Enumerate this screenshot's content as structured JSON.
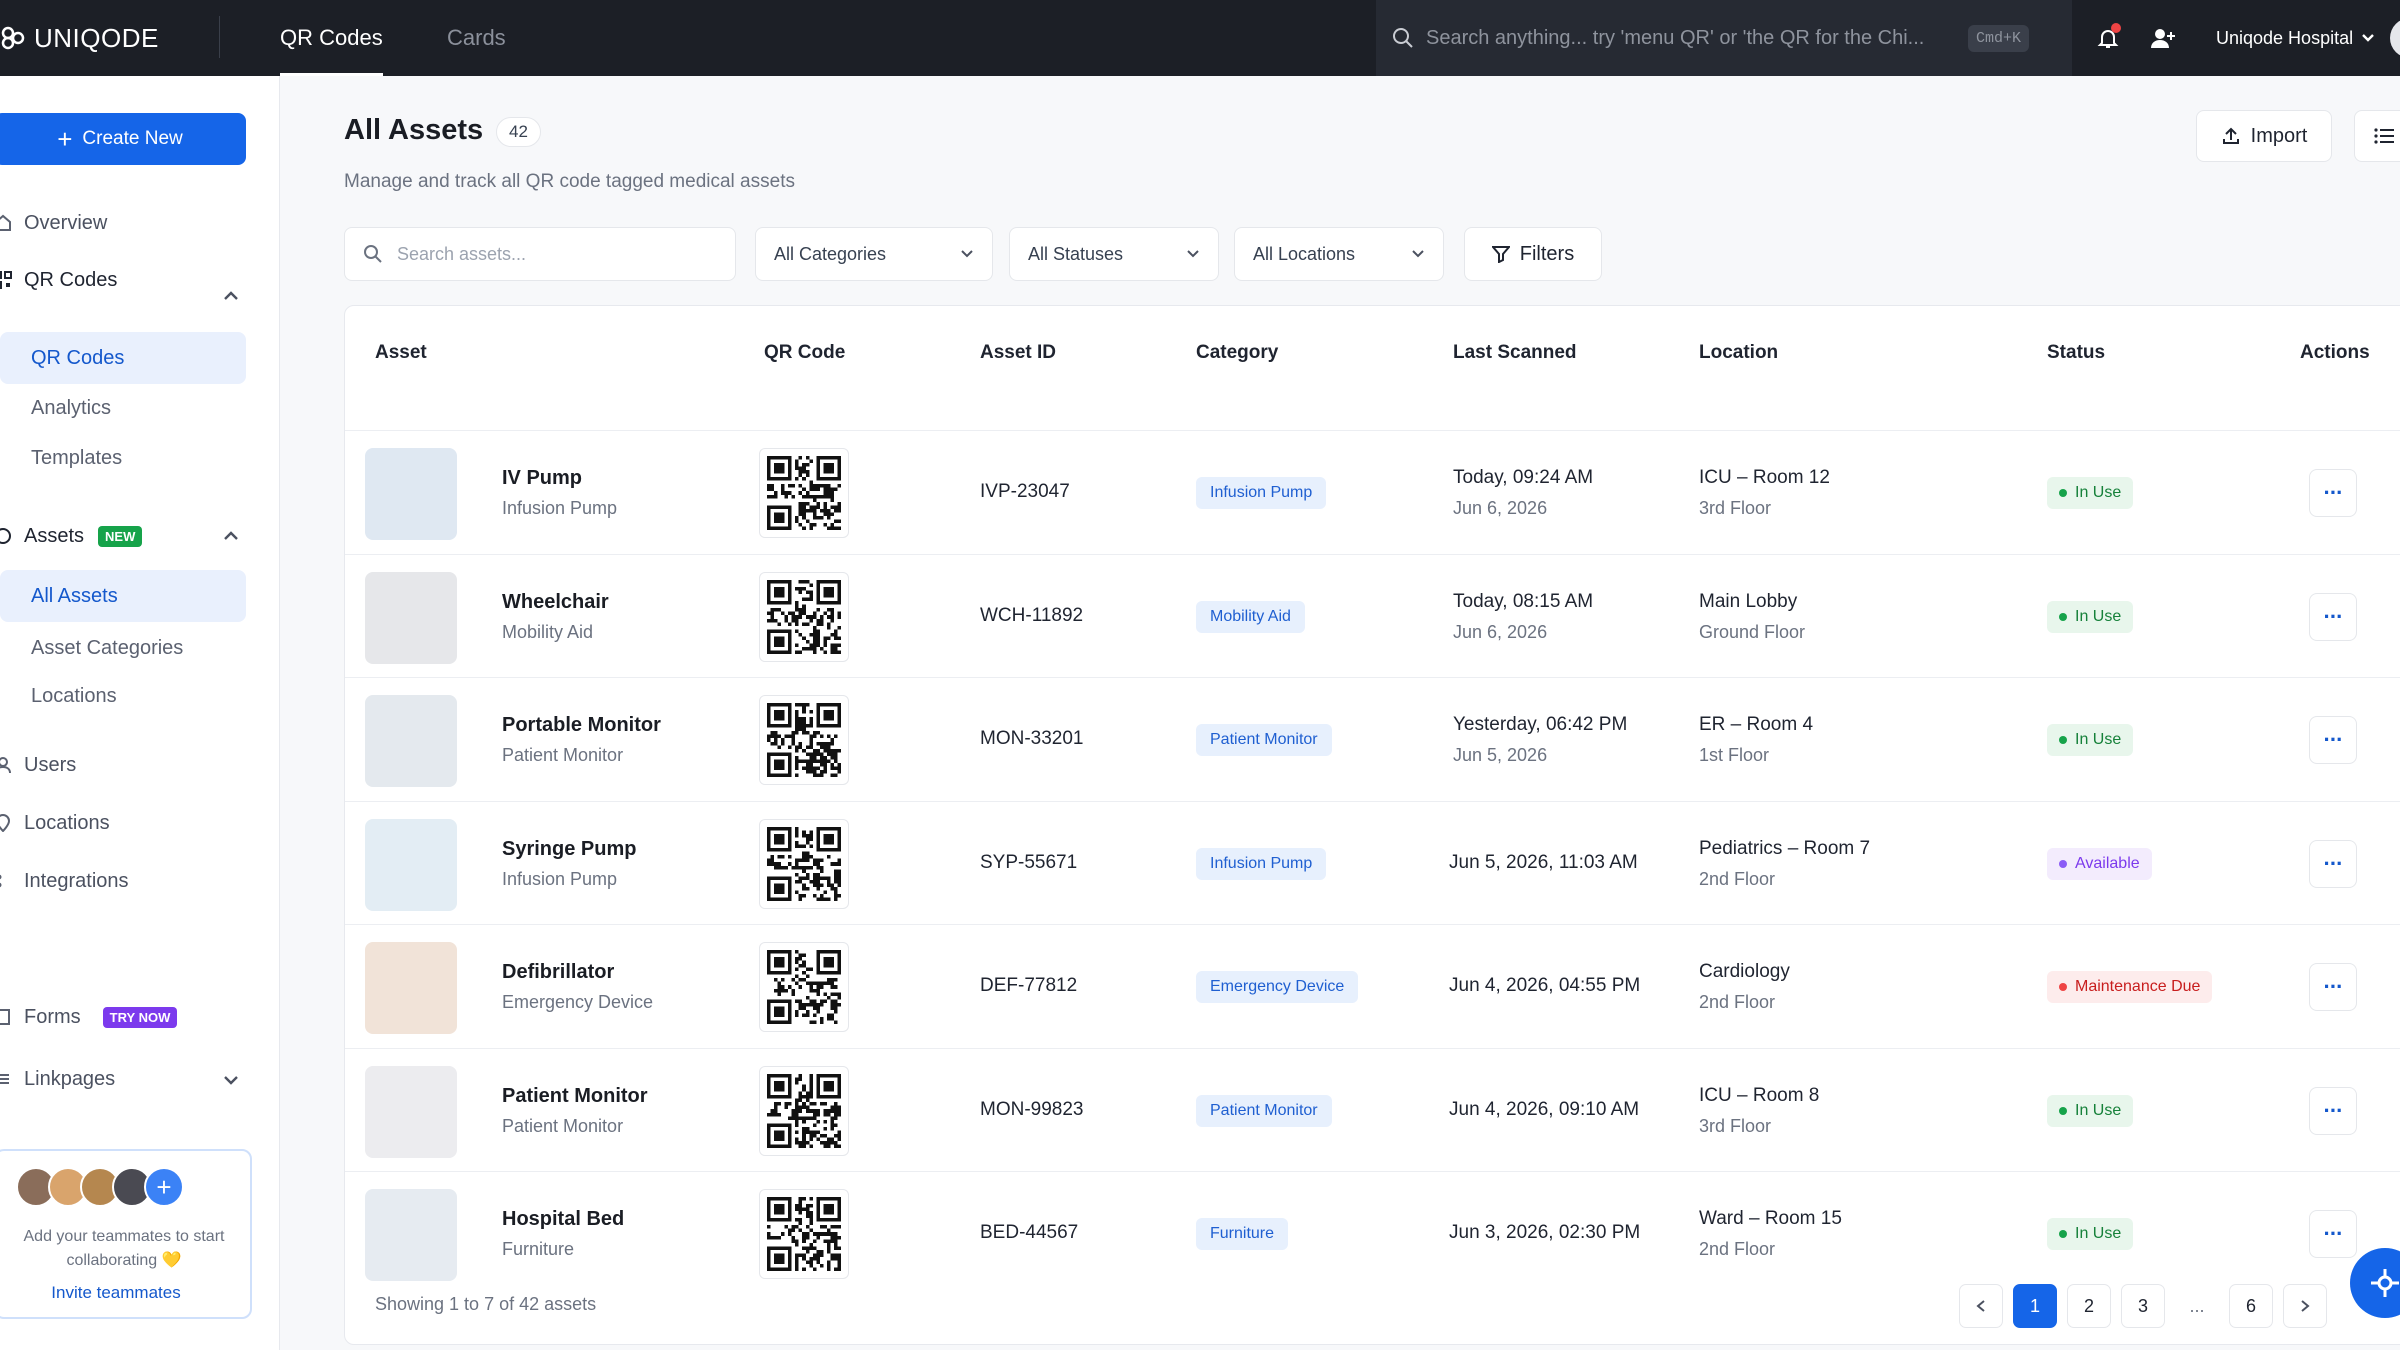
{
  "app": {
    "name": "UNIQODE",
    "org": "Uniqode Hospital",
    "accent": "#1565e8"
  },
  "top_tabs": [
    {
      "label": "QR Codes",
      "active": true
    },
    {
      "label": "Cards",
      "active": false
    }
  ],
  "global_search": {
    "placeholder": "Search anything... try 'menu QR' or 'the QR for the Chi...",
    "shortcut": "Cmd+K"
  },
  "sidebar": {
    "create_label": "Create New",
    "overview": "Overview",
    "qr_section": "QR Codes",
    "qr_items": [
      "QR Codes",
      "Analytics",
      "Templates"
    ],
    "assets_section": "Assets",
    "assets_badge": "NEW",
    "asset_items": [
      "All Assets",
      "Asset Categories",
      "Locations"
    ],
    "users": "Users",
    "locations": "Locations",
    "integrations": "Integrations",
    "forms": "Forms",
    "forms_badge": "TRY NOW",
    "linkpages": "Linkpages",
    "invite_text": "Add your teammates to start collaborating 💛",
    "invite_link": "Invite teammates"
  },
  "main": {
    "title": "All Assets",
    "count": "42",
    "subtitle": "Manage and track all QR code tagged medical assets",
    "import_label": "Import",
    "search_placeholder": "Search assets...",
    "filters": [
      "All Categories",
      "All Statuses",
      "All Locations"
    ],
    "filters_label": "Filters"
  },
  "table": {
    "columns": [
      "Asset",
      "QR Code",
      "Asset ID",
      "Category",
      "Last Scanned",
      "Location",
      "Status",
      "Actions"
    ],
    "rows": [
      {
        "name": "IV Pump",
        "type": "Infusion Pump",
        "id": "IVP-23047",
        "category": "Infusion Pump",
        "scan1": "Today, 09:24 AM",
        "scan2": "Jun 6, 2026",
        "loc1": "ICU – Room 12",
        "loc2": "3rd Floor",
        "status": "In Use"
      },
      {
        "name": "Wheelchair",
        "type": "Mobility Aid",
        "id": "WCH-11892",
        "category": "Mobility Aid",
        "scan1": "Today, 08:15 AM",
        "scan2": "Jun 6, 2026",
        "loc1": "Main Lobby",
        "loc2": "Ground Floor",
        "status": "In Use"
      },
      {
        "name": "Portable Monitor",
        "type": "Patient Monitor",
        "id": "MON-33201",
        "category": "Patient Monitor",
        "scan1": "Yesterday, 06:42 PM",
        "scan2": "Jun 5, 2026",
        "loc1": "ER – Room 4",
        "loc2": "1st Floor",
        "status": "In Use"
      },
      {
        "name": "Syringe Pump",
        "type": "Infusion Pump",
        "id": "SYP-55671",
        "category": "Infusion Pump",
        "scan1": "Jun 5, 2026, 11:03 AM",
        "scan2": "",
        "loc1": "Pediatrics – Room 7",
        "loc2": "2nd Floor",
        "status": "Available"
      },
      {
        "name": "Defibrillator",
        "type": "Emergency Device",
        "id": "DEF-77812",
        "category": "Emergency Device",
        "scan1": "Jun 4, 2026, 04:55 PM",
        "scan2": "",
        "loc1": "Cardiology",
        "loc2": "2nd Floor",
        "status": "Maintenance Due"
      },
      {
        "name": "Patient Monitor",
        "type": "Patient Monitor",
        "id": "MON-99823",
        "category": "Patient Monitor",
        "scan1": "Jun 4, 2026, 09:10 AM",
        "scan2": "",
        "loc1": "ICU – Room 8",
        "loc2": "3rd Floor",
        "status": "In Use"
      },
      {
        "name": "Hospital Bed",
        "type": "Furniture",
        "id": "BED-44567",
        "category": "Furniture",
        "scan1": "Jun 3, 2026, 02:30 PM",
        "scan2": "",
        "loc1": "Ward – Room 15",
        "loc2": "2nd Floor",
        "status": "In Use"
      }
    ],
    "showing": "Showing 1 to 7 of 42 assets",
    "pages": [
      "1",
      "2",
      "3",
      "...",
      "6"
    ],
    "current_page": "1"
  }
}
